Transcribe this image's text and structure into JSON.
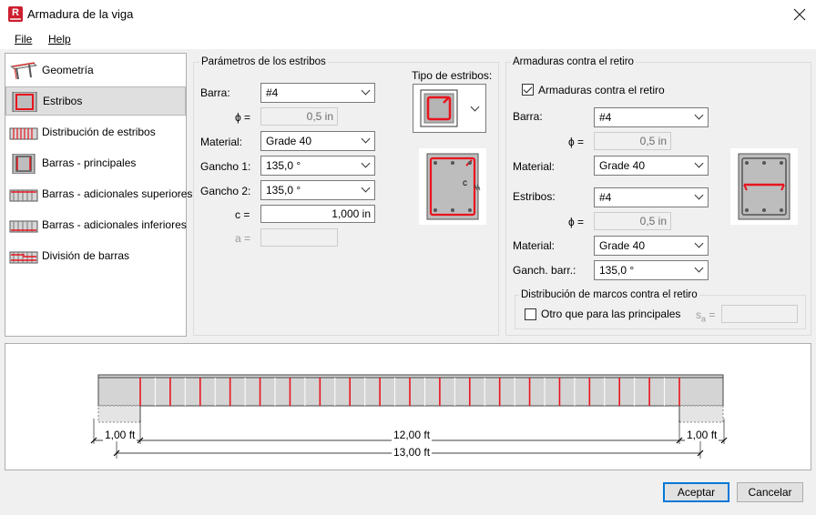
{
  "window": {
    "title": "Armadura de la viga",
    "app_icon": "R"
  },
  "menu": {
    "file": "File",
    "help": "Help"
  },
  "nav": {
    "items": [
      {
        "label": "Geometría",
        "icon": "geometry-icon"
      },
      {
        "label": "Estribos",
        "icon": "stirrups-icon",
        "selected": true
      },
      {
        "label": "Distribución de estribos",
        "icon": "stirrup-distribution-icon"
      },
      {
        "label": "Barras - principales",
        "icon": "main-bars-icon"
      },
      {
        "label": "Barras - adicionales superiores",
        "icon": "top-bars-icon"
      },
      {
        "label": "Barras - adicionales inferiores",
        "icon": "bottom-bars-icon"
      },
      {
        "label": "División de barras",
        "icon": "bar-division-icon"
      }
    ]
  },
  "stirrups": {
    "group_title": "Parámetros de los estribos",
    "barra_label": "Barra:",
    "barra_value": "#4",
    "phi_label": "ϕ =",
    "phi_value": "0,5 in",
    "material_label": "Material:",
    "material_value": "Grade 40",
    "gancho1_label": "Gancho 1:",
    "gancho1_value": "135,0 °",
    "gancho2_label": "Gancho 2:",
    "gancho2_value": "135,0 °",
    "c_label": "c =",
    "c_value": "1,000 in",
    "a_label": "a =",
    "a_value": "",
    "type_label": "Tipo de estribos:",
    "diagram_c_label": "c"
  },
  "retiro": {
    "group_title": "Armaduras contra el retiro",
    "checkbox_label": "Armaduras contra el retiro",
    "checkbox_checked": true,
    "barra_label": "Barra:",
    "barra_value": "#4",
    "phi1_label": "ϕ =",
    "phi1_value": "0,5 in",
    "material1_label": "Material:",
    "material1_value": "Grade 40",
    "estribos_label": "Estribos:",
    "estribos_value": "#4",
    "phi2_label": "ϕ =",
    "phi2_value": "0,5 in",
    "material2_label": "Material:",
    "material2_value": "Grade 40",
    "gancho_label": "Ganch. barr.:",
    "gancho_value": "135,0 °",
    "dist_title": "Distribución de marcos contra el retiro",
    "otro_label": "Otro que para las principales",
    "otro_checked": false,
    "sa_label": "s",
    "sa_sub": "a",
    "sa_eq": " =",
    "sa_value": ""
  },
  "beam": {
    "left_support": "1,00 ft",
    "span": "12,00 ft",
    "right_support": "1,00 ft",
    "total": "13,00 ft",
    "stirrup_count": 19,
    "stirrup_color": "#e8141e"
  },
  "buttons": {
    "accept": "Aceptar",
    "cancel": "Cancelar"
  }
}
